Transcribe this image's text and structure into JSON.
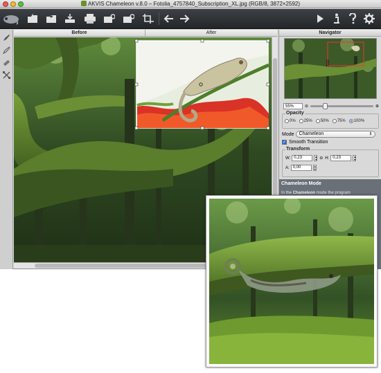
{
  "window": {
    "title": "AKVIS Chameleon v.8.0 – Fotolia_4757840_Subscription_XL.jpg (RGB/8, 3872×2592)"
  },
  "toolbar": {
    "left_icons": [
      "chameleon-logo-icon",
      "open-icon",
      "save-icon",
      "download-icon",
      "print-icon",
      "settings-share-icon",
      "settings-share-icon",
      "crop-icon",
      "back-arrow-icon",
      "forward-arrow-icon"
    ],
    "right_icons": [
      "run-icon",
      "info-icon",
      "help-icon",
      "gear-icon"
    ]
  },
  "tabs": {
    "before": "Before",
    "after": "After"
  },
  "left_tools": [
    "selection-brush-icon",
    "eraser-icon",
    "pencil-icon",
    "transform-icon"
  ],
  "navigator": {
    "title": "Navigator",
    "zoom": "55%",
    "zoom_level": 0.2
  },
  "opacity": {
    "label": "Opacity",
    "options": [
      "0%",
      "25%",
      "50%",
      "75%",
      "100%"
    ],
    "selected": "100%"
  },
  "mode": {
    "label": "Mode",
    "value": "Chameleon"
  },
  "smooth_transition": {
    "label": "Smooth Transition",
    "checked": true
  },
  "transform": {
    "label": "Transform",
    "w_label": "W:",
    "w_value": "0,23",
    "h_label": "H:",
    "h_value": "0,23",
    "a_label": "A:",
    "a_value": "0,00"
  },
  "help": {
    "title": "Chameleon Mode",
    "text_prefix": "In the ",
    "text_bold": "Chameleon",
    "text_suffix": " mode the program"
  },
  "colors": {
    "toolbar": "#2c2f33",
    "accent": "#2a6fd6",
    "foliage": "#3d6a2a",
    "moss": "#5a8a2a"
  }
}
